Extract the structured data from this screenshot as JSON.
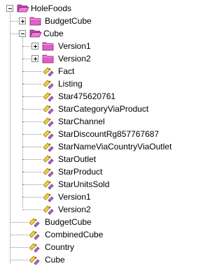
{
  "tree": {
    "root": {
      "label": "HoleFoods",
      "expanded": true
    },
    "nodes": [
      {
        "label": "BudgetCube",
        "kind": "folder",
        "expanded": false
      },
      {
        "label": "Cube",
        "kind": "folder",
        "expanded": true,
        "children": [
          {
            "label": "Version1",
            "kind": "folder",
            "expanded": false
          },
          {
            "label": "Version2",
            "kind": "folder",
            "expanded": false
          },
          {
            "label": "Fact",
            "kind": "item"
          },
          {
            "label": "Listing",
            "kind": "item"
          },
          {
            "label": "Star475620761",
            "kind": "item"
          },
          {
            "label": "StarCategoryViaProduct",
            "kind": "item"
          },
          {
            "label": "StarChannel",
            "kind": "item"
          },
          {
            "label": "StarDiscountRg857767687",
            "kind": "item"
          },
          {
            "label": "StarNameViaCountryViaOutlet",
            "kind": "item"
          },
          {
            "label": "StarOutlet",
            "kind": "item"
          },
          {
            "label": "StarProduct",
            "kind": "item"
          },
          {
            "label": "StarUnitsSold",
            "kind": "item"
          },
          {
            "label": "Version1",
            "kind": "item"
          },
          {
            "label": "Version2",
            "kind": "item"
          }
        ]
      },
      {
        "label": "BudgetCube",
        "kind": "item"
      },
      {
        "label": "CombinedCube",
        "kind": "item"
      },
      {
        "label": "Country",
        "kind": "item"
      },
      {
        "label": "Cube",
        "kind": "item"
      }
    ]
  },
  "colors": {
    "folder": "#e060c0",
    "folder_dark": "#a02890",
    "item_yellow": "#f2d23c",
    "item_purple": "#b070d0",
    "tree_line": "#8a8a8a"
  },
  "icons": {
    "folder": "folder-icon",
    "item": "table-item-icon"
  }
}
